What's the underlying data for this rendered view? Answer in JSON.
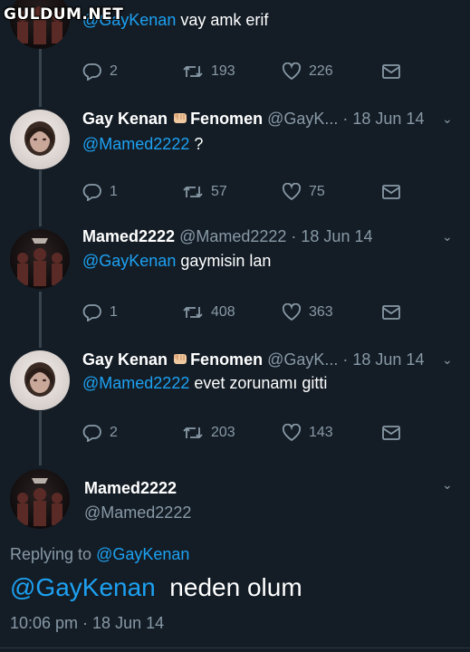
{
  "watermark": "GULDUM.NET",
  "colors": {
    "background": "#141d26",
    "link": "#1da1f2",
    "muted": "#8899a6"
  },
  "tweets": [
    {
      "text_mention": "@GayKenan",
      "text": " vay amk erif",
      "actions": {
        "replies": "2",
        "retweets": "193",
        "likes": "226"
      }
    },
    {
      "name": "Gay Kenan",
      "name_suffix": "Fenomen",
      "name_emoji": "fist-emoji",
      "handle_date": "@GayK... · 18 Jun 14",
      "text_mention": "@Mamed2222",
      "text": " ?",
      "actions": {
        "replies": "1",
        "retweets": "57",
        "likes": "75"
      }
    },
    {
      "name": "Mamed2222",
      "handle_date": "@Mamed2222 · 18 Jun 14",
      "text_mention": "@GayKenan",
      "text": " gaymisin lan",
      "actions": {
        "replies": "1",
        "retweets": "408",
        "likes": "363"
      }
    },
    {
      "name": "Gay Kenan",
      "name_suffix": "Fenomen",
      "name_emoji": "fist-emoji",
      "handle_date": "@GayK... · 18 Jun 14",
      "text_mention": "@Mamed2222",
      "text": " evet zorunamı gitti",
      "actions": {
        "replies": "2",
        "retweets": "203",
        "likes": "143"
      }
    }
  ],
  "focus_tweet": {
    "name": "Mamed2222",
    "handle": "@Mamed2222",
    "replying_label": "Replying to ",
    "replying_mention": "@GayKenan",
    "text_mention": "@GayKenan",
    "text": "  neden olum",
    "time": "10:06 pm · 18 Jun 14"
  },
  "icons": [
    "reply-icon",
    "retweet-icon",
    "like-icon",
    "dm-icon",
    "chevron-down-icon"
  ]
}
